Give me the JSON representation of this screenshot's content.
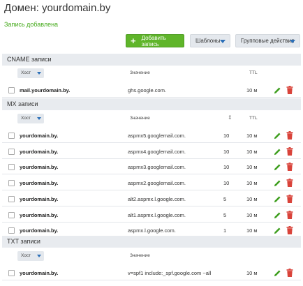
{
  "page": {
    "title": "Домен: yourdomain.by",
    "success_message": "Запись добавлена"
  },
  "toolbar": {
    "add_label": "Добавить запись",
    "templates_label": "Шаблоны",
    "bulk_label": "Групповые действия"
  },
  "columns": {
    "host": "Хост",
    "value": "Значение",
    "priority": "⇕",
    "ttl": "TTL"
  },
  "sections": {
    "cname": {
      "title": "CNAME записи",
      "rows": [
        {
          "host": "mail.yourdomain.by.",
          "value": "ghs.google.com.",
          "priority": "",
          "ttl": "10 м"
        }
      ]
    },
    "mx": {
      "title": "MX записи",
      "rows": [
        {
          "host": "yourdomain.by.",
          "value": "aspmx5.googlemail.com.",
          "priority": "10",
          "ttl": "10 м"
        },
        {
          "host": "yourdomain.by.",
          "value": "aspmx4.googlemail.com.",
          "priority": "10",
          "ttl": "10 м"
        },
        {
          "host": "yourdomain.by.",
          "value": "aspmx3.googlemail.com.",
          "priority": "10",
          "ttl": "10 м"
        },
        {
          "host": "yourdomain.by.",
          "value": "aspmx2.googlemail.com.",
          "priority": "10",
          "ttl": "10 м"
        },
        {
          "host": "yourdomain.by.",
          "value": "alt2.aspmx.l.google.com.",
          "priority": "5",
          "ttl": "10 м"
        },
        {
          "host": "yourdomain.by.",
          "value": "alt1.aspmx.l.google.com.",
          "priority": "5",
          "ttl": "10 м"
        },
        {
          "host": "yourdomain.by.",
          "value": "aspmx.l.google.com.",
          "priority": "1",
          "ttl": "10 м"
        }
      ]
    },
    "txt": {
      "title": "TXT записи",
      "rows": [
        {
          "host": "yourdomain.by.",
          "value": "v=spf1 include:_spf.google.com ~all",
          "priority": "",
          "ttl": "10 м"
        }
      ]
    }
  },
  "icons": {
    "edit": "pencil-icon",
    "delete": "trash-icon",
    "add": "plus-icon",
    "dropdown": "chevron-down-icon"
  },
  "colors": {
    "accent_green": "#5fb52a",
    "success_text": "#44aa1a",
    "edit_icon": "#3e9e1e",
    "delete_icon": "#d9433a",
    "caret_blue": "#2b6fb8",
    "section_bg": "#e8ebef"
  }
}
